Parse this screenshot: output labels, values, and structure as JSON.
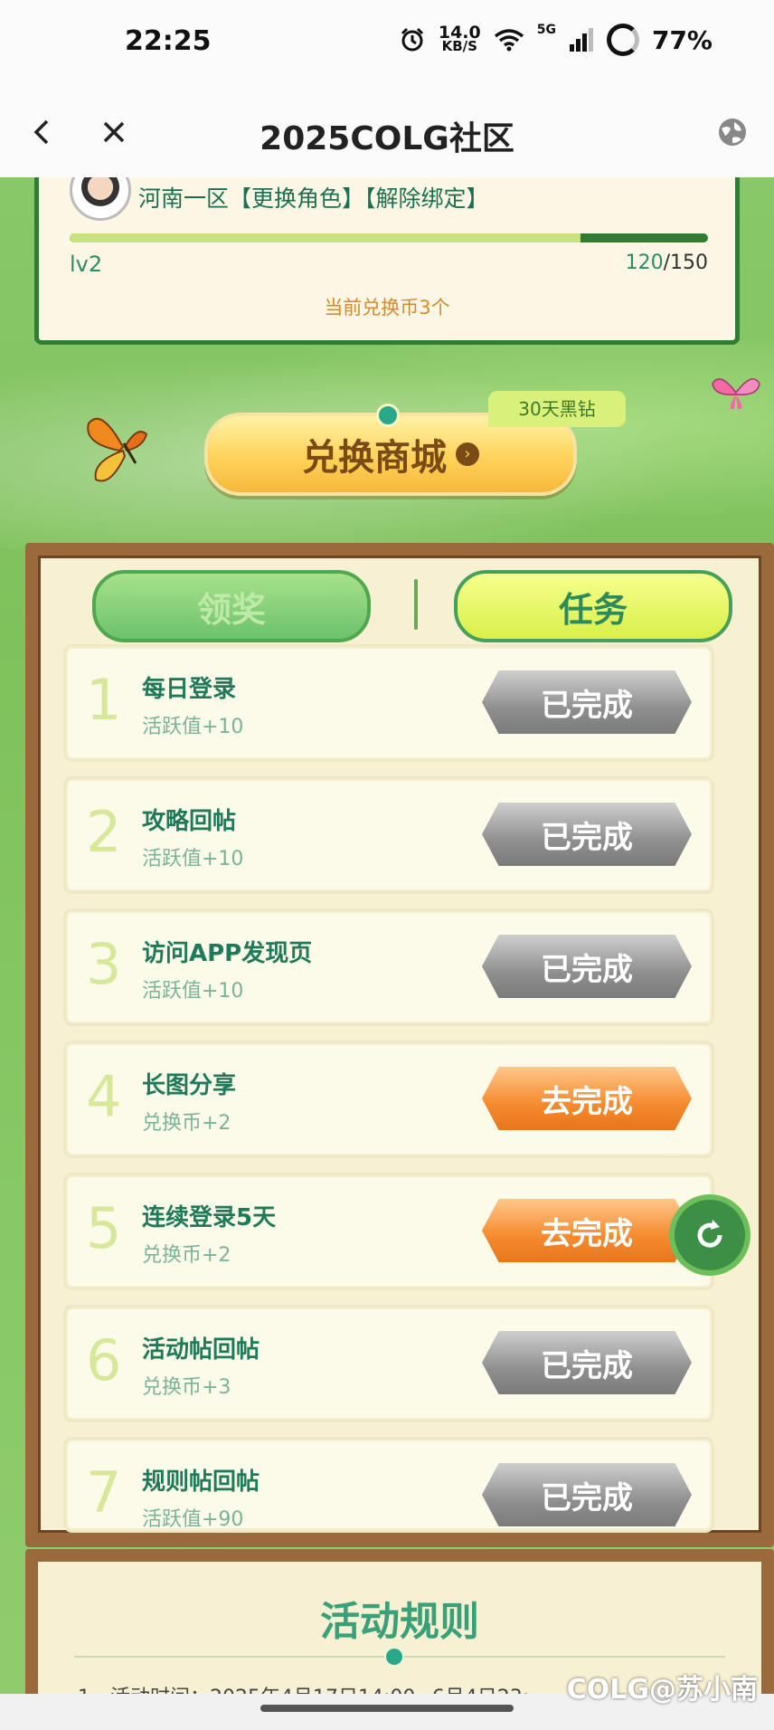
{
  "status_bar": {
    "time": "22:25",
    "net_speed_value": "14.0",
    "net_speed_unit": "KB/S",
    "network": "5G",
    "battery": "77%"
  },
  "nav": {
    "title": "2025COLG社区"
  },
  "user": {
    "server_line": "河南一区【更换角色】【解除绑定】",
    "level": "lv2",
    "points_current": "120",
    "points_max": "/150",
    "progress_fraction": 0.8,
    "coins_text": "当前兑换币3个"
  },
  "shop": {
    "label": "兑换商城",
    "badge": "30天黑钻"
  },
  "tabs": {
    "reward": "领奖",
    "task": "任务"
  },
  "tasks": [
    {
      "num": "1",
      "name": "每日登录",
      "reward": "活跃值+10",
      "status": "已完成",
      "done": true
    },
    {
      "num": "2",
      "name": "攻略回帖",
      "reward": "活跃值+10",
      "status": "已完成",
      "done": true
    },
    {
      "num": "3",
      "name": "访问APP发现页",
      "reward": "活跃值+10",
      "status": "已完成",
      "done": true
    },
    {
      "num": "4",
      "name": "长图分享",
      "reward": "兑换币+2",
      "status": "去完成",
      "done": false
    },
    {
      "num": "5",
      "name": "连续登录5天",
      "reward": "兑换币+2",
      "status": "去完成",
      "done": false
    },
    {
      "num": "6",
      "name": "活动帖回帖",
      "reward": "兑换币+3",
      "status": "已完成",
      "done": true
    },
    {
      "num": "7",
      "name": "规则帖回帖",
      "reward": "活跃值+90",
      "status": "已完成",
      "done": true
    }
  ],
  "rules": {
    "title": "活动规则",
    "first_line": "1、活动时间：2025年4月17日14:00~6月4日23:..."
  },
  "watermark": "COLG@苏小南",
  "colors": {
    "accent_green": "#2e7d32",
    "task_green": "#1f7a5b",
    "done_gray": "#8f8f8f",
    "todo_orange": "#f58a2e",
    "shop_gold": "#ffd25a"
  }
}
